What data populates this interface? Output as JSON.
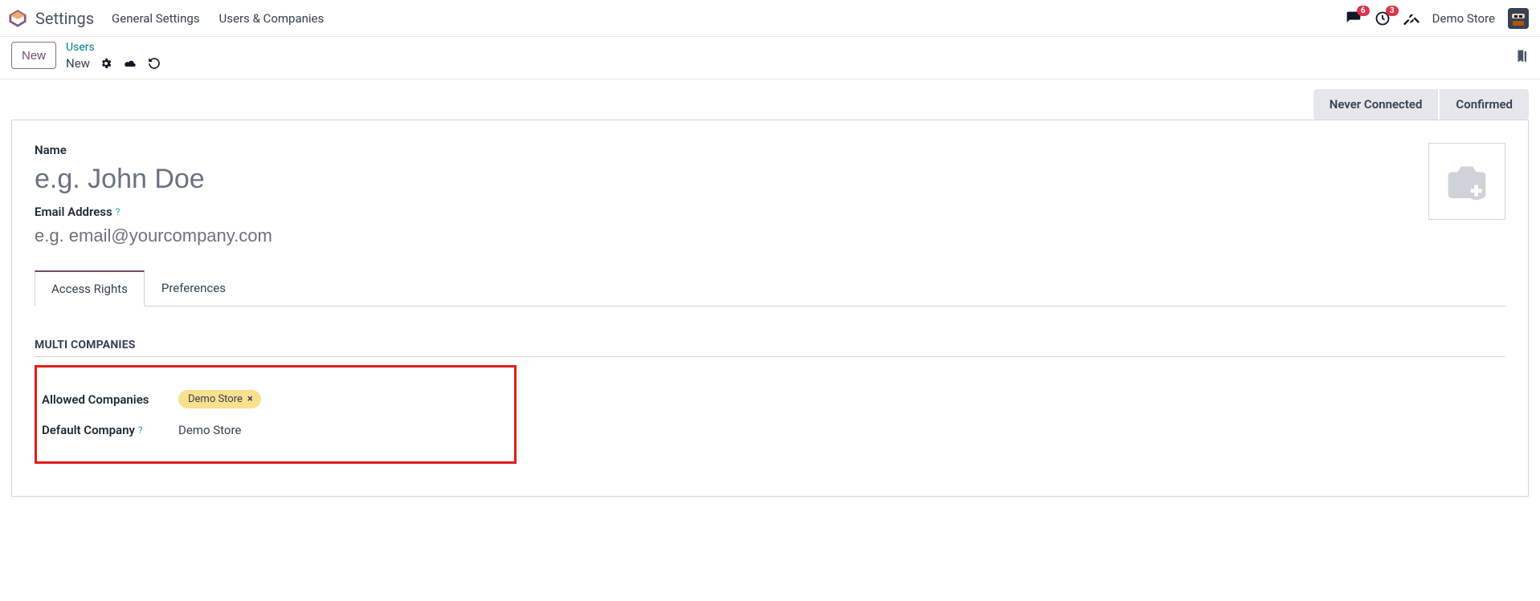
{
  "topbar": {
    "app_title": "Settings",
    "menu": [
      "General Settings",
      "Users & Companies"
    ],
    "messages_badge": "6",
    "activities_badge": "3",
    "company_name": "Demo Store"
  },
  "controlbar": {
    "new_button": "New",
    "breadcrumb_parent": "Users",
    "breadcrumb_current": "New"
  },
  "status": {
    "never_connected": "Never Connected",
    "confirmed": "Confirmed"
  },
  "form": {
    "name_label": "Name",
    "name_placeholder": "e.g. John Doe",
    "email_label": "Email Address",
    "email_placeholder": "e.g. email@yourcompany.com"
  },
  "tabs": {
    "access_rights": "Access Rights",
    "preferences": "Preferences"
  },
  "multi_companies": {
    "section_title": "MULTI COMPANIES",
    "allowed_label": "Allowed Companies",
    "allowed_tag": "Demo Store",
    "default_label": "Default Company",
    "default_value": "Demo Store"
  }
}
